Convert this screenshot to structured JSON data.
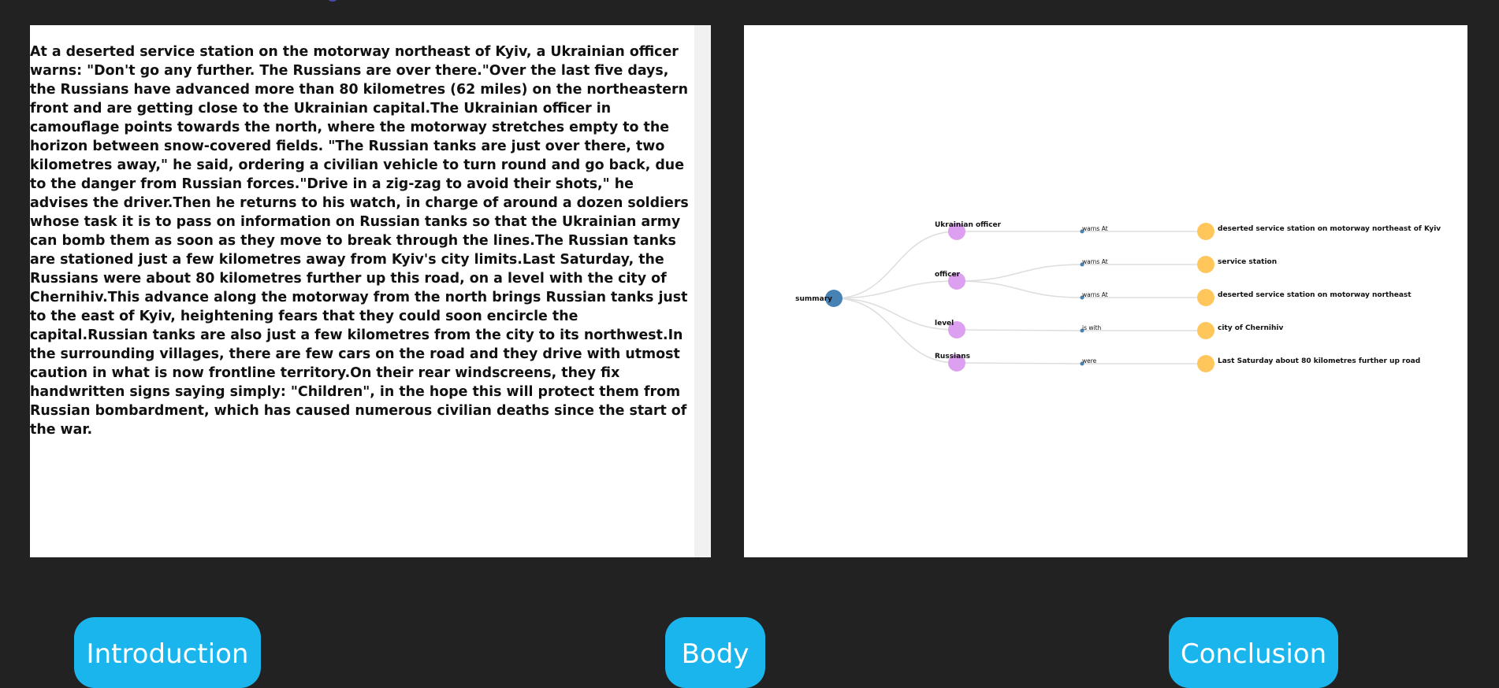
{
  "article": {
    "text": "At a deserted service station on the motorway northeast of Kyiv, a Ukrainian officer warns: \"Don't go any further. The Russians are over there.\"Over the last five days, the Russians have advanced more than 80 kilometres (62 miles) on the northeastern front and are getting close to the Ukrainian capital.The Ukrainian officer in camouflage points towards the north, where the motorway stretches empty to the horizon between snow-covered fields. \"The Russian tanks are just over there, two kilometres away,\" he said, ordering a civilian vehicle to turn round and go back, due to the danger from Russian forces.\"Drive in a zig-zag to avoid their shots,\" he advises the driver.Then he returns to his watch, in charge of around a dozen soldiers whose task it is to pass on information on Russian tanks so that the Ukrainian army can bomb them as soon as they move to break through the lines.The Russian tanks are stationed just a few kilometres away from Kyiv's city limits.Last Saturday, the Russians were about 80 kilometres further up this road, on a level with the city of Chernihiv.This advance along the motorway from the north brings Russian tanks just to the east of Kyiv, heightening fears that they could soon encircle the capital.Russian tanks are also just a few kilometres from the city to its northwest.In the surrounding villages, there are few cars on the road and they drive with utmost caution in what is now frontline territory.On their rear windscreens, they fix handwritten signs saying simply: \"Children\", in the hope this will protect them from Russian bombardment, which has caused numerous civilian deaths since the start of the war."
  },
  "tree": {
    "root": "summary",
    "colors": {
      "root": "#4682b4",
      "subject": "#dda0f0",
      "relation": "#4682b4",
      "object": "#ffc65c",
      "link": "#dddddd"
    },
    "subjects": [
      "Ukrainian officer",
      "officer",
      "level",
      "Russians"
    ],
    "relations": [
      "warns At",
      "warns At",
      "warns At",
      "is with",
      "were"
    ],
    "objects": [
      "deserted service station on motorway northeast of Kyiv",
      "service station",
      "deserted service station on motorway northeast",
      "city of Chernihiv",
      "Last Saturday about 80 kilometres further up road"
    ]
  },
  "nav": {
    "introduction": "Introduction",
    "body": "Body",
    "conclusion": "Conclusion"
  }
}
